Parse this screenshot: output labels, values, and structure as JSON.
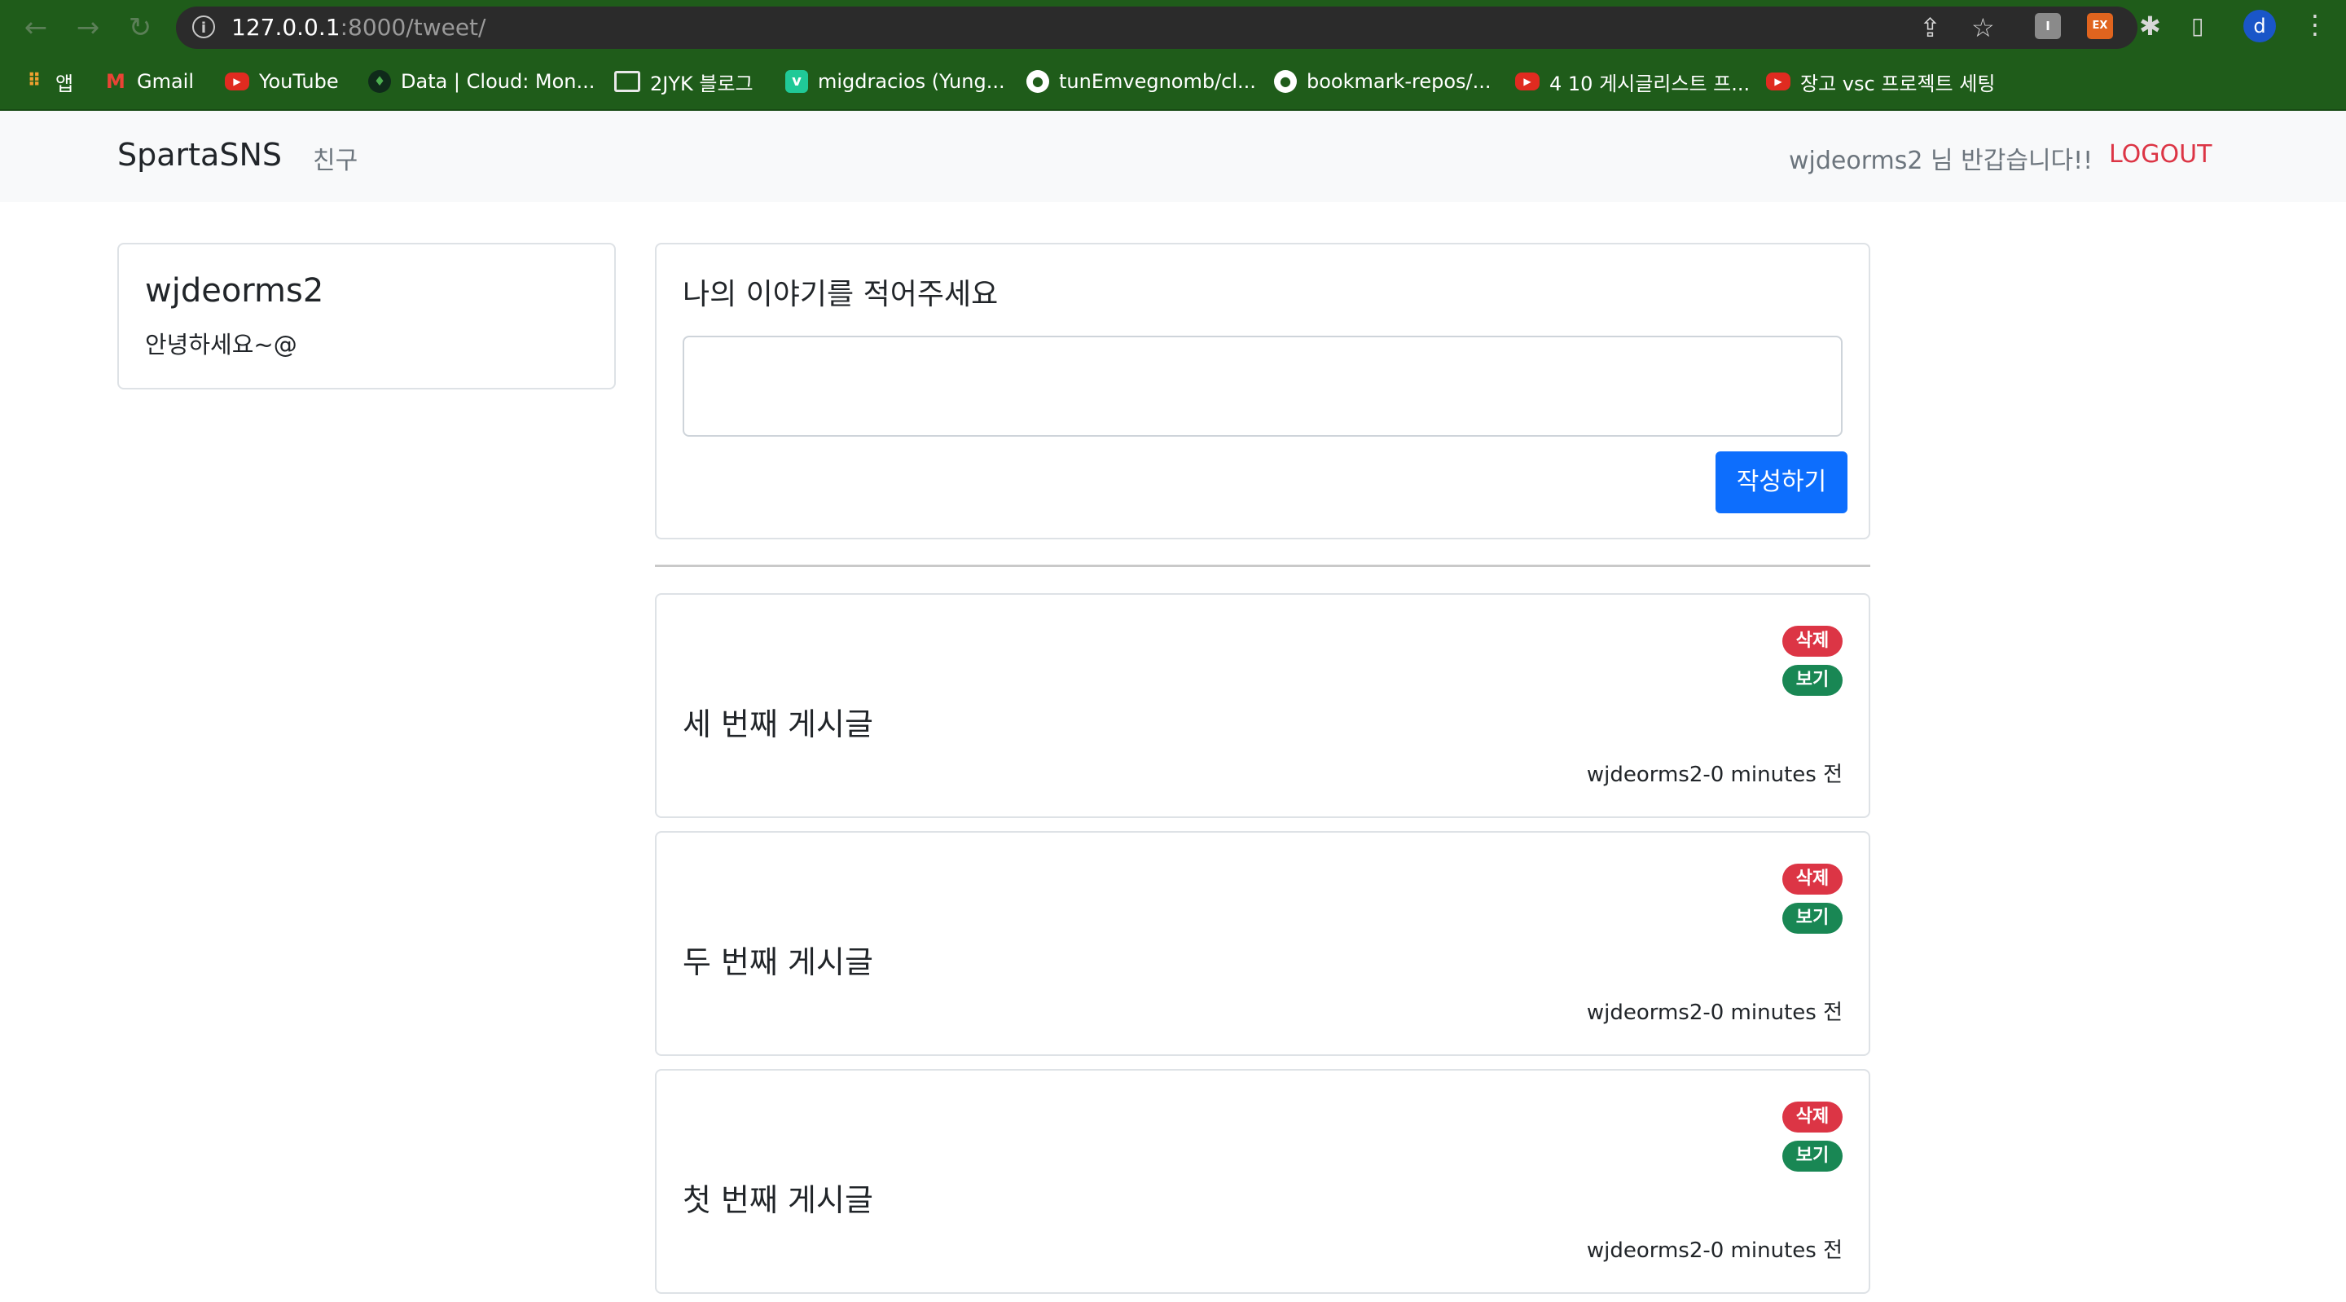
{
  "browser": {
    "url_host": "127.0.0.1",
    "url_path": ":8000/tweet/",
    "profile_initial": "d",
    "ext1_label": "I",
    "ext2_label": "EX",
    "bookmarks": [
      {
        "label": "앱",
        "icon": "apps-grid-icon"
      },
      {
        "label": "Gmail",
        "icon": "gmail-icon"
      },
      {
        "label": "YouTube",
        "icon": "youtube-icon"
      },
      {
        "label": "Data | Cloud: Mon...",
        "icon": "mongodb-icon"
      },
      {
        "label": "2JYK 블로그",
        "icon": "folder-icon"
      },
      {
        "label": "migdracios (Yung...",
        "icon": "velog-icon"
      },
      {
        "label": "tunEmvegnomb/cl...",
        "icon": "github-icon"
      },
      {
        "label": "bookmark-repos/...",
        "icon": "github-icon"
      },
      {
        "label": "4 10 게시글리스트 프...",
        "icon": "youtube-icon"
      },
      {
        "label": "장고 vsc 프로젝트 세팅",
        "icon": "youtube-icon"
      }
    ]
  },
  "navbar": {
    "brand": "SpartaSNS",
    "friend_link": "친구",
    "greeting": "wjdeorms2 님 반갑습니다!!",
    "logout": "LOGOUT"
  },
  "profile": {
    "username": "wjdeorms2",
    "bio": "안녕하세요~@"
  },
  "compose": {
    "title": "나의 이야기를 적어주세요",
    "input_value": "",
    "submit_label": "작성하기"
  },
  "posts": [
    {
      "title": "세 번째 게시글",
      "meta": "wjdeorms2-0 minutes 전",
      "delete_label": "삭제",
      "view_label": "보기"
    },
    {
      "title": "두 번째 게시글",
      "meta": "wjdeorms2-0 minutes 전",
      "delete_label": "삭제",
      "view_label": "보기"
    },
    {
      "title": "첫 번째 게시글",
      "meta": "wjdeorms2-0 minutes 전",
      "delete_label": "삭제",
      "view_label": "보기"
    }
  ],
  "colors": {
    "browser_theme": "#1f5c1a",
    "primary": "#0d6efd",
    "danger": "#dc3545",
    "success": "#198754"
  }
}
